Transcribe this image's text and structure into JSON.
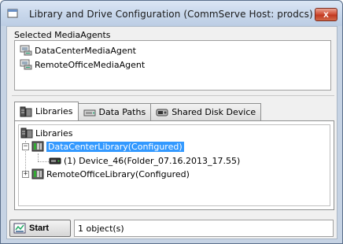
{
  "window": {
    "title": "Library and Drive Configuration (CommServe Host: prodcs)",
    "close_label": "x"
  },
  "media_agents": {
    "label": "Selected MediaAgents",
    "items": [
      {
        "label": "DataCenterMediaAgent",
        "icon": "media-agent-icon"
      },
      {
        "label": "RemoteOfficeMediaAgent",
        "icon": "media-agent-icon"
      }
    ]
  },
  "tabs": [
    {
      "label": "Libraries",
      "icon": "libraries-icon",
      "active": true
    },
    {
      "label": "Data Paths",
      "icon": "data-paths-icon",
      "active": false
    },
    {
      "label": "Shared Disk Device",
      "icon": "shared-disk-icon",
      "active": false
    }
  ],
  "tree": {
    "root": {
      "label": "Libraries",
      "icon": "libraries-icon"
    },
    "nodes": [
      {
        "label": "DataCenterLibrary(Configured)",
        "expander": "−",
        "selected": true,
        "icon": "library-icon"
      },
      {
        "label": "(1) Device_46(Folder_07.16.2013_17.55)",
        "icon": "device-icon"
      },
      {
        "label": "RemoteOfficeLibrary(Configured)",
        "expander": "+",
        "selected": false,
        "icon": "library-icon"
      }
    ]
  },
  "footer": {
    "start_label": "Start",
    "status_text": "1 object(s)"
  },
  "colors": {
    "selection": "#3399ff",
    "close_button": "#c23a22",
    "frame": "#c6d3e4"
  }
}
